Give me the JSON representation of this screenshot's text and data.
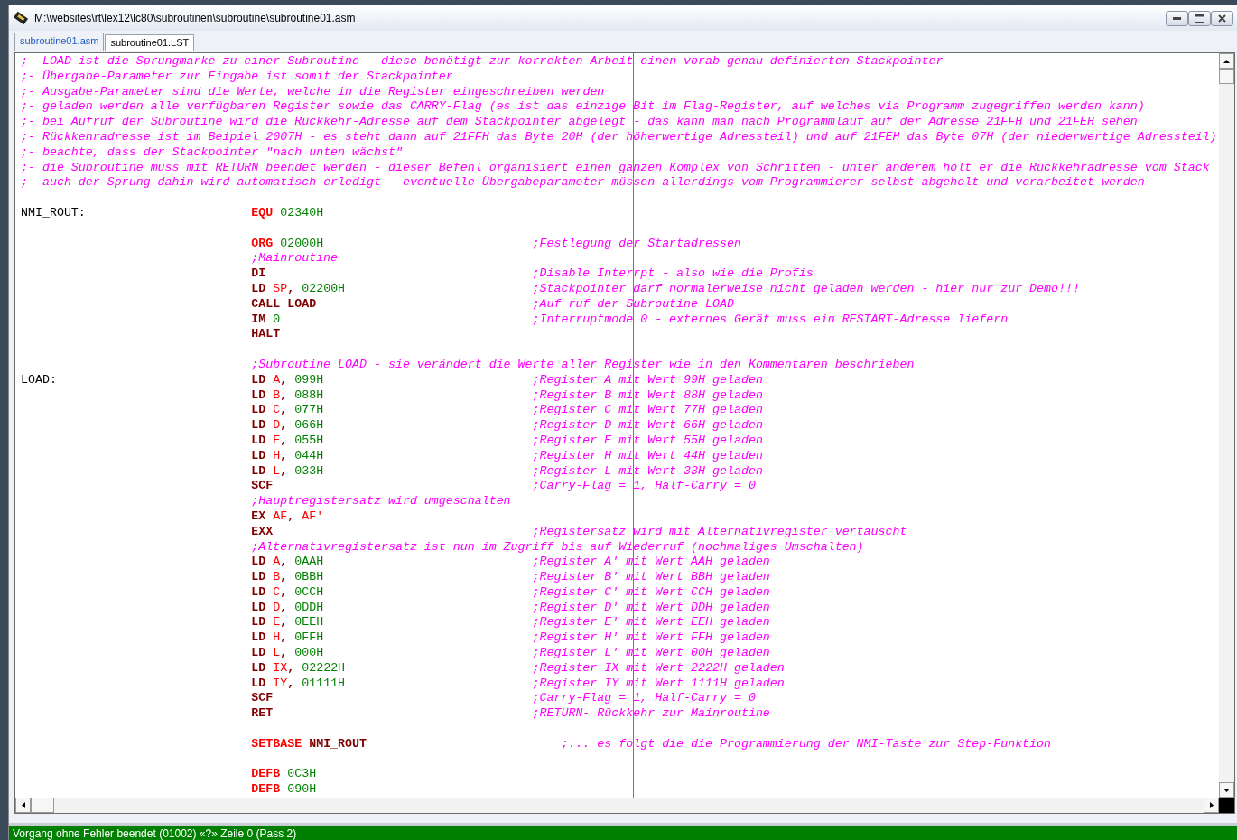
{
  "window": {
    "title": "M:\\websites\\rt\\lex12\\lc80\\subroutinen\\subroutine\\subroutine01.asm"
  },
  "tabs": [
    {
      "label": "subroutine01.asm",
      "selected": true
    },
    {
      "label": "subroutine01.LST",
      "selected": false
    }
  ],
  "editor": {
    "lines": [
      {
        "kind": "note",
        "text": ";- LOAD ist die Sprungmarke zu einer Subroutine - diese benötigt zur korrekten Arbeit einen vorab genau definierten Stackpointer"
      },
      {
        "kind": "note",
        "text": ";- Übergabe-Parameter zur Eingabe ist somit der Stackpointer"
      },
      {
        "kind": "note",
        "text": ";- Ausgabe-Parameter sind die Werte, welche in die Register eingeschreiben werden"
      },
      {
        "kind": "note",
        "text": ";- geladen werden alle verfügbaren Register sowie das CARRY-Flag (es ist das einzige Bit im Flag-Register, auf welches via Programm zugegriffen werden kann)"
      },
      {
        "kind": "note",
        "text": ";- bei Aufruf der Subroutine wird die Rückkehr-Adresse auf dem Stackpointer abgelegt - das kann man nach Programmlauf auf der Adresse 21FFH und 21FEH sehen"
      },
      {
        "kind": "note",
        "text": ";- Rückkehradresse ist im Beipiel 2007H - es steht dann auf 21FFH das Byte 20H (der höherwertige Adressteil) und auf 21FEH das Byte 07H (der niederwertige Adressteil)"
      },
      {
        "kind": "note",
        "text": ";- beachte, dass der Stackpointer \"nach unten wächst\""
      },
      {
        "kind": "note",
        "text": ";- die Subroutine muss mit RETURN beendet werden - dieser Befehl organisiert einen ganzen Komplex von Schritten - unter anderem holt er die Rückkehradresse vom Stack"
      },
      {
        "kind": "note",
        "text": ";  auch der Sprung dahin wird automatisch erledigt - eventuelle Übergabeparameter müssen allerdings vom Programmierer selbst abgeholt und verarbeitet werden"
      },
      {
        "kind": "blank"
      },
      {
        "kind": "code",
        "label": "NMI_ROUT:",
        "instr": [
          {
            "kind": "directive",
            "text": "EQU"
          },
          {
            "kind": "num",
            "text": "02340H"
          }
        ]
      },
      {
        "kind": "blank"
      },
      {
        "kind": "code",
        "instr": [
          {
            "kind": "directive",
            "text": "ORG"
          },
          {
            "kind": "num",
            "text": "02000H"
          }
        ],
        "comment": ";Festlegung der Startadressen"
      },
      {
        "kind": "code",
        "instr": [
          {
            "kind": "comment",
            "text": ";Mainroutine"
          }
        ]
      },
      {
        "kind": "code",
        "instr": [
          {
            "kind": "op",
            "text": "DI"
          }
        ],
        "comment": ";Disable Interrpt - also wie die Profis"
      },
      {
        "kind": "code",
        "instr": [
          {
            "kind": "op",
            "text": "LD"
          },
          {
            "kind": "reg",
            "text": "SP"
          },
          {
            "kind": "punct",
            "text": ","
          },
          {
            "kind": "num",
            "text": "02200H"
          }
        ],
        "comment": ";Stackpointer darf normalerweise nicht geladen werden - hier nur zur Demo!!!"
      },
      {
        "kind": "code",
        "instr": [
          {
            "kind": "op",
            "text": "CALL"
          },
          {
            "kind": "op",
            "text": "LOAD"
          }
        ],
        "comment": ";Auf ruf der Subroutine LOAD"
      },
      {
        "kind": "code",
        "instr": [
          {
            "kind": "op",
            "text": "IM"
          },
          {
            "kind": "num",
            "text": "0"
          }
        ],
        "comment": ";Interruptmode 0 - externes Gerät muss ein RESTART-Adresse liefern"
      },
      {
        "kind": "code",
        "instr": [
          {
            "kind": "op",
            "text": "HALT"
          }
        ]
      },
      {
        "kind": "blank"
      },
      {
        "kind": "code",
        "instr": [
          {
            "kind": "comment",
            "text": ";Subroutine LOAD - sie verändert die Werte aller Register wie in den Kommentaren beschrieben"
          }
        ]
      },
      {
        "kind": "code",
        "label": "LOAD:",
        "instr": [
          {
            "kind": "op",
            "text": "LD"
          },
          {
            "kind": "reg",
            "text": "A"
          },
          {
            "kind": "punct",
            "text": ","
          },
          {
            "kind": "num",
            "text": "099H"
          }
        ],
        "comment": ";Register A mit Wert 99H geladen"
      },
      {
        "kind": "code",
        "instr": [
          {
            "kind": "op",
            "text": "LD"
          },
          {
            "kind": "reg",
            "text": "B"
          },
          {
            "kind": "punct",
            "text": ","
          },
          {
            "kind": "num",
            "text": "088H"
          }
        ],
        "comment": ";Register B mit Wert 88H geladen"
      },
      {
        "kind": "code",
        "instr": [
          {
            "kind": "op",
            "text": "LD"
          },
          {
            "kind": "reg",
            "text": "C"
          },
          {
            "kind": "punct",
            "text": ","
          },
          {
            "kind": "num",
            "text": "077H"
          }
        ],
        "comment": ";Register C mit Wert 77H geladen"
      },
      {
        "kind": "code",
        "instr": [
          {
            "kind": "op",
            "text": "LD"
          },
          {
            "kind": "reg",
            "text": "D"
          },
          {
            "kind": "punct",
            "text": ","
          },
          {
            "kind": "num",
            "text": "066H"
          }
        ],
        "comment": ";Register D mit Wert 66H geladen"
      },
      {
        "kind": "code",
        "instr": [
          {
            "kind": "op",
            "text": "LD"
          },
          {
            "kind": "reg",
            "text": "E"
          },
          {
            "kind": "punct",
            "text": ","
          },
          {
            "kind": "num",
            "text": "055H"
          }
        ],
        "comment": ";Register E mit Wert 55H geladen"
      },
      {
        "kind": "code",
        "instr": [
          {
            "kind": "op",
            "text": "LD"
          },
          {
            "kind": "reg",
            "text": "H"
          },
          {
            "kind": "punct",
            "text": ","
          },
          {
            "kind": "num",
            "text": "044H"
          }
        ],
        "comment": ";Register H mit Wert 44H geladen"
      },
      {
        "kind": "code",
        "instr": [
          {
            "kind": "op",
            "text": "LD"
          },
          {
            "kind": "reg",
            "text": "L"
          },
          {
            "kind": "punct",
            "text": ","
          },
          {
            "kind": "num",
            "text": "033H"
          }
        ],
        "comment": ";Register L mit Wert 33H geladen"
      },
      {
        "kind": "code",
        "instr": [
          {
            "kind": "op",
            "text": "SCF"
          }
        ],
        "comment": ";Carry-Flag = 1, Half-Carry = 0"
      },
      {
        "kind": "code",
        "instr": [
          {
            "kind": "comment",
            "text": ";Hauptregistersatz wird umgeschalten"
          }
        ]
      },
      {
        "kind": "code",
        "instr": [
          {
            "kind": "op",
            "text": "EX"
          },
          {
            "kind": "reg",
            "text": "AF"
          },
          {
            "kind": "punct",
            "text": ","
          },
          {
            "kind": "reg",
            "text": "AF'"
          }
        ]
      },
      {
        "kind": "code",
        "instr": [
          {
            "kind": "op",
            "text": "EXX"
          }
        ],
        "comment": ";Registersatz wird mit Alternativregister vertauscht"
      },
      {
        "kind": "code",
        "instr": [
          {
            "kind": "comment",
            "text": ";Alternativregistersatz ist nun im Zugriff bis auf Wiederruf (nochmaliges Umschalten)"
          }
        ]
      },
      {
        "kind": "code",
        "instr": [
          {
            "kind": "op",
            "text": "LD"
          },
          {
            "kind": "reg",
            "text": "A"
          },
          {
            "kind": "punct",
            "text": ","
          },
          {
            "kind": "num",
            "text": "0AAH"
          }
        ],
        "comment": ";Register A' mit Wert AAH geladen"
      },
      {
        "kind": "code",
        "instr": [
          {
            "kind": "op",
            "text": "LD"
          },
          {
            "kind": "reg",
            "text": "B"
          },
          {
            "kind": "punct",
            "text": ","
          },
          {
            "kind": "num",
            "text": "0BBH"
          }
        ],
        "comment": ";Register B' mit Wert BBH geladen"
      },
      {
        "kind": "code",
        "instr": [
          {
            "kind": "op",
            "text": "LD"
          },
          {
            "kind": "reg",
            "text": "C"
          },
          {
            "kind": "punct",
            "text": ","
          },
          {
            "kind": "num",
            "text": "0CCH"
          }
        ],
        "comment": ";Register C' mit Wert CCH geladen"
      },
      {
        "kind": "code",
        "instr": [
          {
            "kind": "op",
            "text": "LD"
          },
          {
            "kind": "reg",
            "text": "D"
          },
          {
            "kind": "punct",
            "text": ","
          },
          {
            "kind": "num",
            "text": "0DDH"
          }
        ],
        "comment": ";Register D' mit Wert DDH geladen"
      },
      {
        "kind": "code",
        "instr": [
          {
            "kind": "op",
            "text": "LD"
          },
          {
            "kind": "reg",
            "text": "E"
          },
          {
            "kind": "punct",
            "text": ","
          },
          {
            "kind": "num",
            "text": "0EEH"
          }
        ],
        "comment": ";Register E' mit Wert EEH geladen"
      },
      {
        "kind": "code",
        "instr": [
          {
            "kind": "op",
            "text": "LD"
          },
          {
            "kind": "reg",
            "text": "H"
          },
          {
            "kind": "punct",
            "text": ","
          },
          {
            "kind": "num",
            "text": "0FFH"
          }
        ],
        "comment": ";Register H' mit Wert FFH geladen"
      },
      {
        "kind": "code",
        "instr": [
          {
            "kind": "op",
            "text": "LD"
          },
          {
            "kind": "reg",
            "text": "L"
          },
          {
            "kind": "punct",
            "text": ","
          },
          {
            "kind": "num",
            "text": "000H"
          }
        ],
        "comment": ";Register L' mit Wert 00H geladen"
      },
      {
        "kind": "code",
        "instr": [
          {
            "kind": "op",
            "text": "LD"
          },
          {
            "kind": "reg",
            "text": "IX"
          },
          {
            "kind": "punct",
            "text": ","
          },
          {
            "kind": "num",
            "text": "02222H"
          }
        ],
        "comment": ";Register IX mit Wert 2222H geladen"
      },
      {
        "kind": "code",
        "instr": [
          {
            "kind": "op",
            "text": "LD"
          },
          {
            "kind": "reg",
            "text": "IY"
          },
          {
            "kind": "punct",
            "text": ","
          },
          {
            "kind": "num",
            "text": "01111H"
          }
        ],
        "comment": ";Register IY mit Wert 1111H geladen"
      },
      {
        "kind": "code",
        "instr": [
          {
            "kind": "op",
            "text": "SCF"
          }
        ],
        "comment": ";Carry-Flag = 1, Half-Carry = 0"
      },
      {
        "kind": "code",
        "instr": [
          {
            "kind": "op",
            "text": "RET"
          }
        ],
        "comment": ";RETURN- Rückkehr zur Mainroutine"
      },
      {
        "kind": "blank"
      },
      {
        "kind": "code",
        "instr": [
          {
            "kind": "directive",
            "text": "SETBASE"
          },
          {
            "kind": "op",
            "text": "NMI_ROUT"
          }
        ],
        "comment": "    ;... es folgt die die Programmierung der NMI-Taste zur Step-Funktion"
      },
      {
        "kind": "blank"
      },
      {
        "kind": "code",
        "instr": [
          {
            "kind": "directive",
            "text": "DEFB"
          },
          {
            "kind": "num",
            "text": "0C3H"
          }
        ]
      },
      {
        "kind": "code",
        "instr": [
          {
            "kind": "directive",
            "text": "DEFB"
          },
          {
            "kind": "num",
            "text": "090H"
          }
        ]
      }
    ]
  },
  "status_bar": {
    "text": "Vorgang ohne Fehler beendet (01002) «?» Zeile 0 (Pass 2)"
  }
}
